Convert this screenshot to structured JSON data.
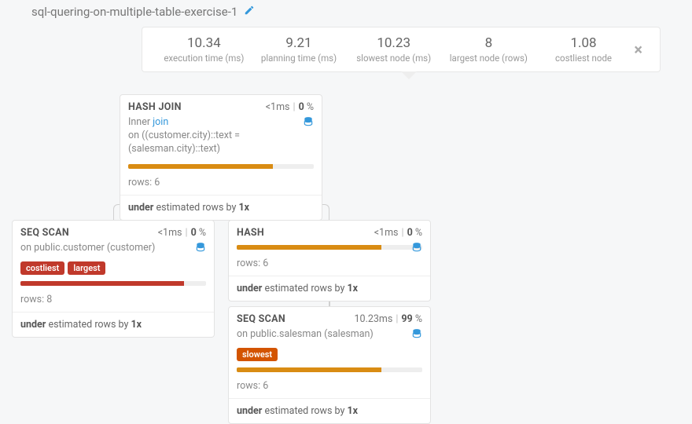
{
  "title": "sql-quering-on-multiple-table-exercise-1",
  "metrics": {
    "execution_time": {
      "value": "10.34",
      "label": "execution time (ms)"
    },
    "planning_time": {
      "value": "9.21",
      "label": "planning time (ms)"
    },
    "slowest_node": {
      "value": "10.23",
      "label": "slowest node (ms)"
    },
    "largest_node": {
      "value": "8",
      "label": "largest node (rows)"
    },
    "costliest_node": {
      "value": "1.08",
      "label": "costliest node"
    }
  },
  "nodes": {
    "hash_join": {
      "title": "HASH JOIN",
      "time": "<1ms",
      "pct": "0",
      "detail_prefix": "Inner ",
      "detail_link": "join",
      "detail_on_prefix": "on ",
      "detail_on": "((customer.city)::text = (salesman.city)::text)",
      "rows_label": "rows: ",
      "rows": "6",
      "est_prefix": "under",
      "est_mid": " estimated rows by ",
      "est_factor": "1x"
    },
    "seq_customer": {
      "title": "SEQ SCAN",
      "time": "<1ms",
      "pct": "0",
      "on_prefix": "on ",
      "on": "public.customer (customer)",
      "badges": [
        "costliest",
        "largest"
      ],
      "rows_label": "rows: ",
      "rows": "8",
      "est_prefix": "under",
      "est_mid": " estimated rows by ",
      "est_factor": "1x"
    },
    "hash": {
      "title": "HASH",
      "time": "<1ms",
      "pct": "0",
      "rows_label": "rows: ",
      "rows": "6",
      "est_prefix": "under",
      "est_mid": " estimated rows by ",
      "est_factor": "1x"
    },
    "seq_salesman": {
      "title": "SEQ SCAN",
      "time": "10.23ms",
      "pct": "99",
      "on_prefix": "on ",
      "on": "public.salesman (salesman)",
      "badges": [
        "slowest"
      ],
      "rows_label": "rows: ",
      "rows": "6",
      "est_prefix": "under",
      "est_mid": " estimated rows by ",
      "est_factor": "1x"
    }
  },
  "pct_suffix": " %"
}
